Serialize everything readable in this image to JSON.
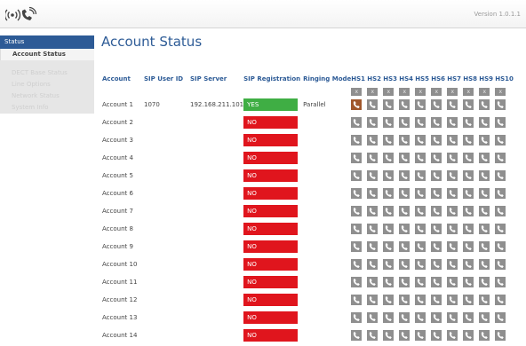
{
  "header": {
    "version": "Version 1.0.1.1"
  },
  "sidebar": {
    "items": [
      {
        "label": "Status",
        "type": "active-parent"
      },
      {
        "label": "Account Status",
        "type": "current"
      },
      {
        "label": "",
        "type": "spacer"
      },
      {
        "label": "DECT Base Status",
        "type": "sub"
      },
      {
        "label": "Line Options",
        "type": "sub"
      },
      {
        "label": "Network Status",
        "type": "sub"
      },
      {
        "label": "System Info",
        "type": "sub"
      }
    ]
  },
  "page": {
    "title": "Account Status"
  },
  "table": {
    "headers": [
      "Account",
      "SIP User ID",
      "SIP Server",
      "SIP Registration",
      "Ringing Mode",
      "HS1",
      "HS2",
      "HS3",
      "HS4",
      "HS5",
      "HS6",
      "HS7",
      "HS8",
      "HS9",
      "HS10"
    ],
    "x_label": "x",
    "rows": [
      {
        "account": "Account 1",
        "user_id": "1070",
        "server": "192.168.211.101",
        "registration": "YES",
        "ringing": "Parallel",
        "hs_active": [
          true,
          false,
          false,
          false,
          false,
          false,
          false,
          false,
          false,
          false
        ]
      },
      {
        "account": "Account 2",
        "user_id": "",
        "server": "",
        "registration": "NO",
        "ringing": "",
        "hs_active": [
          false,
          false,
          false,
          false,
          false,
          false,
          false,
          false,
          false,
          false
        ]
      },
      {
        "account": "Account 3",
        "user_id": "",
        "server": "",
        "registration": "NO",
        "ringing": "",
        "hs_active": [
          false,
          false,
          false,
          false,
          false,
          false,
          false,
          false,
          false,
          false
        ]
      },
      {
        "account": "Account 4",
        "user_id": "",
        "server": "",
        "registration": "NO",
        "ringing": "",
        "hs_active": [
          false,
          false,
          false,
          false,
          false,
          false,
          false,
          false,
          false,
          false
        ]
      },
      {
        "account": "Account 5",
        "user_id": "",
        "server": "",
        "registration": "NO",
        "ringing": "",
        "hs_active": [
          false,
          false,
          false,
          false,
          false,
          false,
          false,
          false,
          false,
          false
        ]
      },
      {
        "account": "Account 6",
        "user_id": "",
        "server": "",
        "registration": "NO",
        "ringing": "",
        "hs_active": [
          false,
          false,
          false,
          false,
          false,
          false,
          false,
          false,
          false,
          false
        ]
      },
      {
        "account": "Account 7",
        "user_id": "",
        "server": "",
        "registration": "NO",
        "ringing": "",
        "hs_active": [
          false,
          false,
          false,
          false,
          false,
          false,
          false,
          false,
          false,
          false
        ]
      },
      {
        "account": "Account 8",
        "user_id": "",
        "server": "",
        "registration": "NO",
        "ringing": "",
        "hs_active": [
          false,
          false,
          false,
          false,
          false,
          false,
          false,
          false,
          false,
          false
        ]
      },
      {
        "account": "Account 9",
        "user_id": "",
        "server": "",
        "registration": "NO",
        "ringing": "",
        "hs_active": [
          false,
          false,
          false,
          false,
          false,
          false,
          false,
          false,
          false,
          false
        ]
      },
      {
        "account": "Account 10",
        "user_id": "",
        "server": "",
        "registration": "NO",
        "ringing": "",
        "hs_active": [
          false,
          false,
          false,
          false,
          false,
          false,
          false,
          false,
          false,
          false
        ]
      },
      {
        "account": "Account 11",
        "user_id": "",
        "server": "",
        "registration": "NO",
        "ringing": "",
        "hs_active": [
          false,
          false,
          false,
          false,
          false,
          false,
          false,
          false,
          false,
          false
        ]
      },
      {
        "account": "Account 12",
        "user_id": "",
        "server": "",
        "registration": "NO",
        "ringing": "",
        "hs_active": [
          false,
          false,
          false,
          false,
          false,
          false,
          false,
          false,
          false,
          false
        ]
      },
      {
        "account": "Account 13",
        "user_id": "",
        "server": "",
        "registration": "NO",
        "ringing": "",
        "hs_active": [
          false,
          false,
          false,
          false,
          false,
          false,
          false,
          false,
          false,
          false
        ]
      },
      {
        "account": "Account 14",
        "user_id": "",
        "server": "",
        "registration": "NO",
        "ringing": "",
        "hs_active": [
          false,
          false,
          false,
          false,
          false,
          false,
          false,
          false,
          false,
          false
        ]
      }
    ]
  },
  "colors": {
    "accent": "#2d5b96",
    "registered": "#3fae44",
    "unregistered": "#e0151d",
    "handset_idle": "#8f8f8f",
    "handset_active": "#a0572b"
  },
  "icons": {
    "logo": "dect-phone-logo-icon",
    "handset": "handset-icon"
  }
}
